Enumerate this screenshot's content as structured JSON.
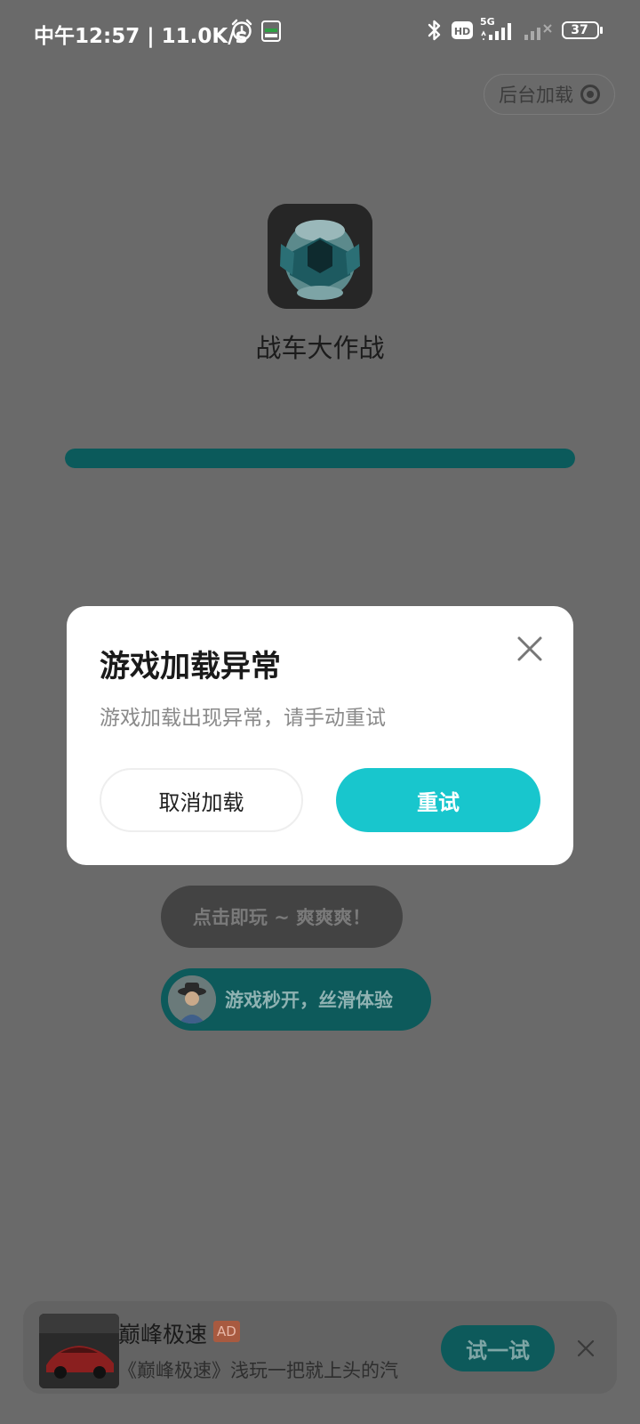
{
  "status_bar": {
    "time": "中午12:57 | 11.0K/s",
    "network": "5G",
    "hd": "HD",
    "battery": "37"
  },
  "header": {
    "background_load_label": "后台加载"
  },
  "game": {
    "name": "战车大作战",
    "progress": 1.0,
    "progress_color": "#0b5a5b"
  },
  "dialog": {
    "title": "游戏加载异常",
    "message": "游戏加载出现异常，请手动重试",
    "cancel_label": "取消加载",
    "retry_label": "重试",
    "accent": "#18c6cd"
  },
  "promos": [
    {
      "label": "点击即玩 ~ 爽爽爽！"
    },
    {
      "label": "游戏秒开，丝滑体验"
    }
  ],
  "ad": {
    "title": "巅峰极速",
    "badge": "AD",
    "description": "《巅峰极速》浅玩一把就上头的汽",
    "button_label": "试一试"
  }
}
